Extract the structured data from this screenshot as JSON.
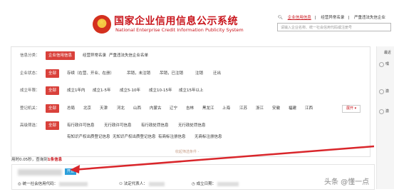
{
  "header": {
    "title": "国家企业信用信息公示系统",
    "subtitle": "National Enterprise Credit Information Publicity System",
    "links": [
      "企业信用信息",
      "经营异常名录",
      "严重违法失信企业"
    ],
    "search_placeholder": "请输入企业名称、统一社会信用代码或注册号"
  },
  "filters": {
    "rows": [
      {
        "label": "信息分类：",
        "selected": "企业信用信息",
        "options": [
          "经营异常名录",
          "严重违法失信企业名单"
        ]
      },
      {
        "label": "企业状态：",
        "selected": "全部",
        "options": [
          "存续（在营、开业、在册）",
          "吊销，未注销",
          "吊销，已注销",
          "注销",
          "迁出"
        ]
      },
      {
        "label": "成立年限：",
        "selected": "全部",
        "options": [
          "成立1年内",
          "成立1-5年",
          "成立5-10年",
          "成立10-15年",
          "成立15年以上"
        ]
      },
      {
        "label": "登记机关：",
        "selected": "全部",
        "options": [
          "总局",
          "北京",
          "天津",
          "河北",
          "山西",
          "内蒙古",
          "辽宁",
          "吉林",
          "黑龙江",
          "上海",
          "江苏",
          "浙江",
          "安徽",
          "福建",
          "江西"
        ],
        "expand_label": "展开 ▾"
      },
      {
        "label": "高级筛选：",
        "selected": "全部",
        "options": [
          "有行政许可信息",
          "无行政许可信息",
          "有行政处罚信息",
          "无行政处罚信息"
        ],
        "options2": [
          "有知识产权出质登记信息",
          "无知识产权出质登记信息",
          "有商标注册信息",
          "无商标注册信息"
        ]
      }
    ],
    "collapse_label": "收起筛选条件 -"
  },
  "right_panel": {
    "title": "最近",
    "items": [
      "嘿",
      "激",
      "激"
    ]
  },
  "results": {
    "time_text": "用时0.05秒，查询到",
    "count_text": "1条信息",
    "card": {
      "badge": "开业",
      "credit_code_label": "统一社会信用代码：",
      "legal_rep_label": "法定代表人：",
      "established_label": "成立日期："
    }
  },
  "watermark": "头条 @懂一点"
}
